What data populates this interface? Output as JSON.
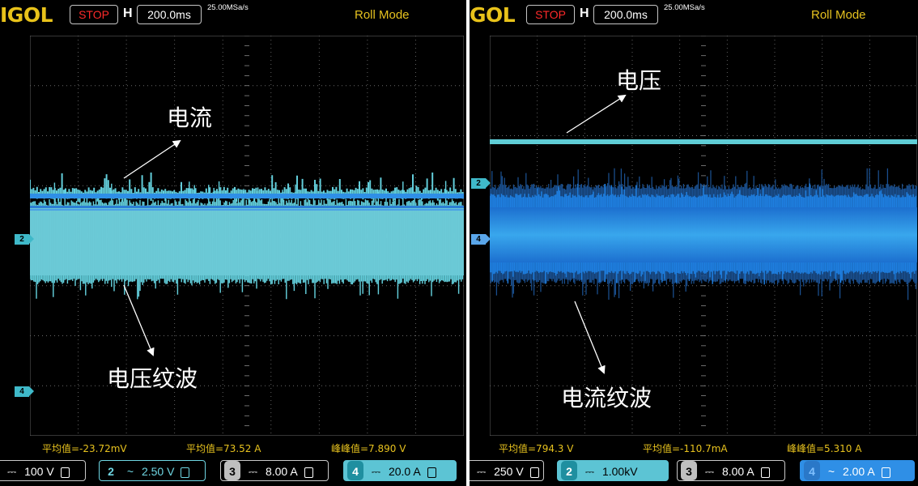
{
  "left": {
    "logo": "IGOL",
    "status": "STOP",
    "timebase_prefix": "H",
    "timebase": "200.0ms",
    "sample_rate": "25.00MSa/s",
    "mode": "Roll Mode",
    "ch_markers": [
      "2",
      "4"
    ],
    "measurements": [
      "平均值=-23.72mV",
      "平均值=73.52 A",
      "峰峰值=7.890 V"
    ],
    "channels": [
      {
        "num": "",
        "coupling": "⎓",
        "scale": "100 V"
      },
      {
        "num": "2",
        "coupling": "~",
        "scale": "2.50 V"
      },
      {
        "num": "3",
        "coupling": "⎓",
        "scale": "8.00 A"
      },
      {
        "num": "4",
        "coupling": "⎓",
        "scale": "20.0 A"
      }
    ],
    "annotations": {
      "current": "电流",
      "ripple": "电压纹波"
    },
    "colors": {
      "trace_cyan": "#63cfdc",
      "trace_blue": "#2f8fe6"
    }
  },
  "right": {
    "logo": "GOL",
    "status": "STOP",
    "timebase_prefix": "H",
    "timebase": "200.0ms",
    "sample_rate": "25.00MSa/s",
    "mode": "Roll Mode",
    "ch_markers": [
      "2",
      "4"
    ],
    "measurements": [
      "平均值=794.3 V",
      "平均值=-110.7mA",
      "峰峰值=5.310 A"
    ],
    "channels": [
      {
        "num": "",
        "coupling": "⎓",
        "scale": "250 V"
      },
      {
        "num": "2",
        "coupling": "⎓",
        "scale": "1.00kV"
      },
      {
        "num": "3",
        "coupling": "⎓",
        "scale": "8.00 A"
      },
      {
        "num": "4",
        "coupling": "~",
        "scale": "2.00 A"
      }
    ],
    "annotations": {
      "voltage": "电压",
      "ripple": "电流纹波"
    },
    "colors": {
      "trace_cyan": "#5fcdd6",
      "trace_blue": "#1e7fe0"
    }
  }
}
